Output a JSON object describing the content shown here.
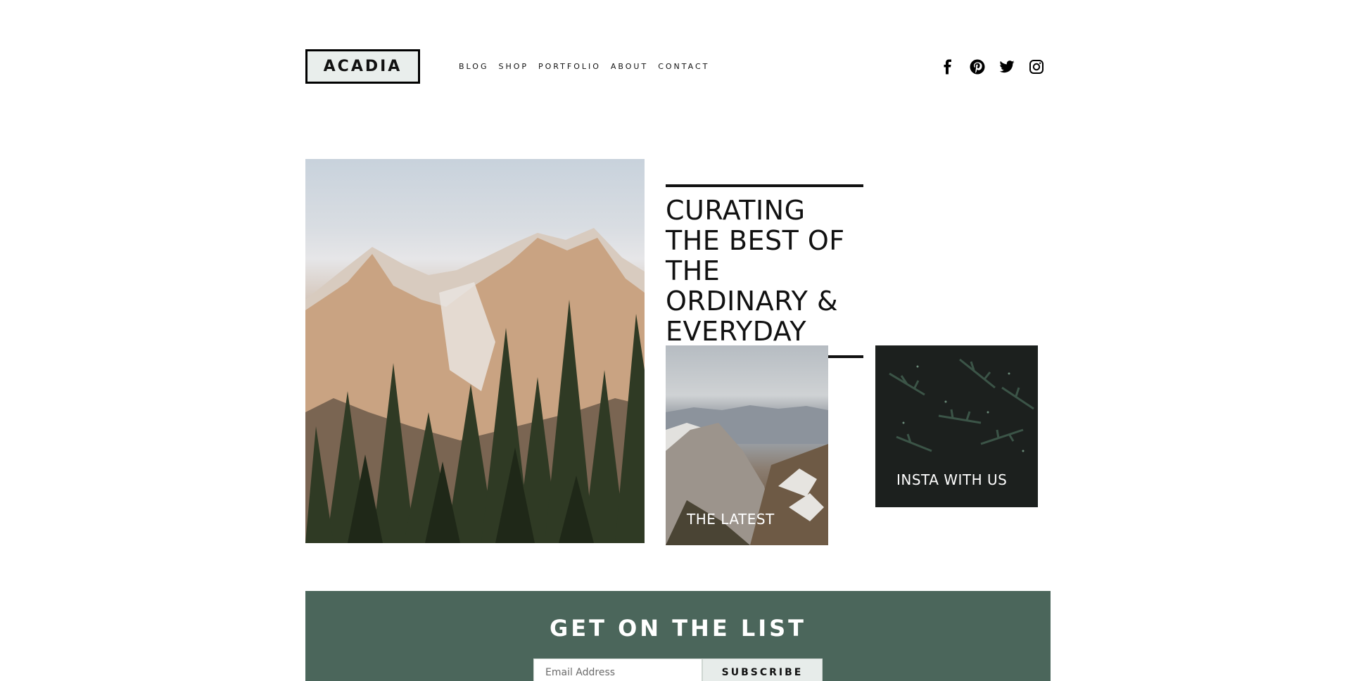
{
  "header": {
    "logo": "ACADIA",
    "nav": [
      "BLOG",
      "SHOP",
      "PORTFOLIO",
      "ABOUT",
      "CONTACT"
    ],
    "social_icons": [
      "facebook-icon",
      "pinterest-icon",
      "twitter-icon",
      "instagram-icon"
    ]
  },
  "hero": {
    "headline": "CURATING THE BEST OF THE ORDINARY & EVERYDAY"
  },
  "tiles": [
    {
      "label": "THE LATEST"
    },
    {
      "label": "INSTA WITH US"
    }
  ],
  "newsletter": {
    "title": "GET ON THE LIST",
    "email_placeholder": "Email Address",
    "button_label": "SUBSCRIBE",
    "background_color": "#4b665b"
  }
}
